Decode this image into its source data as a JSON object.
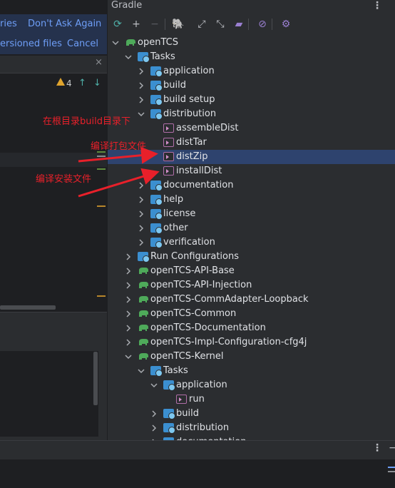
{
  "notification": {
    "link1": "ries",
    "link2": "Don't Ask Again",
    "link3": "ersioned files",
    "link4": "Cancel"
  },
  "editor": {
    "close_glyph": "×",
    "warning_count": "4",
    "up_arrow": "↑",
    "down_arrow": "↓"
  },
  "gradle_panel": {
    "title": "Gradle",
    "menu_glyph": "⋮",
    "toolbar": [
      {
        "name": "refresh-icon",
        "glyph": "⟳"
      },
      {
        "name": "add-icon",
        "glyph": "+"
      },
      {
        "name": "remove-icon",
        "glyph": "−"
      },
      {
        "name": "elephant-icon",
        "glyph": "🐘"
      },
      {
        "name": "expand-all-icon",
        "glyph": "⤢"
      },
      {
        "name": "collapse-all-icon",
        "glyph": "⤡"
      },
      {
        "name": "folder-icon",
        "glyph": "▰"
      },
      {
        "name": "offline-icon",
        "glyph": "⊘"
      },
      {
        "name": "settings-icon",
        "glyph": "⚙"
      }
    ],
    "tree": [
      {
        "label": "openTCS",
        "icon": "elephant",
        "level": 0,
        "expanded": true
      },
      {
        "label": "Tasks",
        "icon": "folder",
        "level": 1,
        "expanded": true
      },
      {
        "label": "application",
        "icon": "folder",
        "level": 2,
        "expanded": false
      },
      {
        "label": "build",
        "icon": "folder",
        "level": 2,
        "expanded": false
      },
      {
        "label": "build setup",
        "icon": "folder",
        "level": 2,
        "expanded": false
      },
      {
        "label": "distribution",
        "icon": "folder",
        "level": 2,
        "expanded": true
      },
      {
        "label": "assembleDist",
        "icon": "task",
        "level": 3
      },
      {
        "label": "distTar",
        "icon": "task",
        "level": 3
      },
      {
        "label": "distZip",
        "icon": "task",
        "level": 3,
        "selected": true
      },
      {
        "label": "installDist",
        "icon": "task",
        "level": 3
      },
      {
        "label": "documentation",
        "icon": "folder",
        "level": 2,
        "expanded": false
      },
      {
        "label": "help",
        "icon": "folder",
        "level": 2,
        "expanded": false
      },
      {
        "label": "license",
        "icon": "folder",
        "level": 2,
        "expanded": false
      },
      {
        "label": "other",
        "icon": "folder",
        "level": 2,
        "expanded": false
      },
      {
        "label": "verification",
        "icon": "folder",
        "level": 2,
        "expanded": false
      },
      {
        "label": "Run Configurations",
        "icon": "folder",
        "level": 1,
        "expanded": false
      },
      {
        "label": "openTCS-API-Base",
        "icon": "elephant",
        "level": 1,
        "expanded": false
      },
      {
        "label": "openTCS-API-Injection",
        "icon": "elephant",
        "level": 1,
        "expanded": false
      },
      {
        "label": "openTCS-CommAdapter-Loopback",
        "icon": "elephant",
        "level": 1,
        "expanded": false
      },
      {
        "label": "openTCS-Common",
        "icon": "elephant",
        "level": 1,
        "expanded": false
      },
      {
        "label": "openTCS-Documentation",
        "icon": "elephant",
        "level": 1,
        "expanded": false
      },
      {
        "label": "openTCS-Impl-Configuration-cfg4j",
        "icon": "elephant",
        "level": 1,
        "expanded": false
      },
      {
        "label": "openTCS-Kernel",
        "icon": "elephant",
        "level": 1,
        "expanded": true
      },
      {
        "label": "Tasks",
        "icon": "folder",
        "level": 2,
        "expanded": true
      },
      {
        "label": "application",
        "icon": "folder",
        "level": 3,
        "expanded": true
      },
      {
        "label": "run",
        "icon": "task",
        "level": 4
      },
      {
        "label": "build",
        "icon": "folder",
        "level": 3,
        "expanded": false
      },
      {
        "label": "distribution",
        "icon": "folder",
        "level": 3,
        "expanded": false
      },
      {
        "label": "documentation",
        "icon": "folder",
        "level": 3,
        "expanded": false
      }
    ]
  },
  "bottom_panel": {
    "menu_glyph": "⋮",
    "minimize_glyph": "−"
  },
  "annotations": {
    "note1": "在根目录build目录下",
    "note2": "编译打包文件",
    "note3": "编译安装文件"
  },
  "colors": {
    "annotation_red": "#e8202a",
    "selection": "#2e436e",
    "folder_blue": "#3b8fd0",
    "gradle_green": "#4eaa5a"
  }
}
